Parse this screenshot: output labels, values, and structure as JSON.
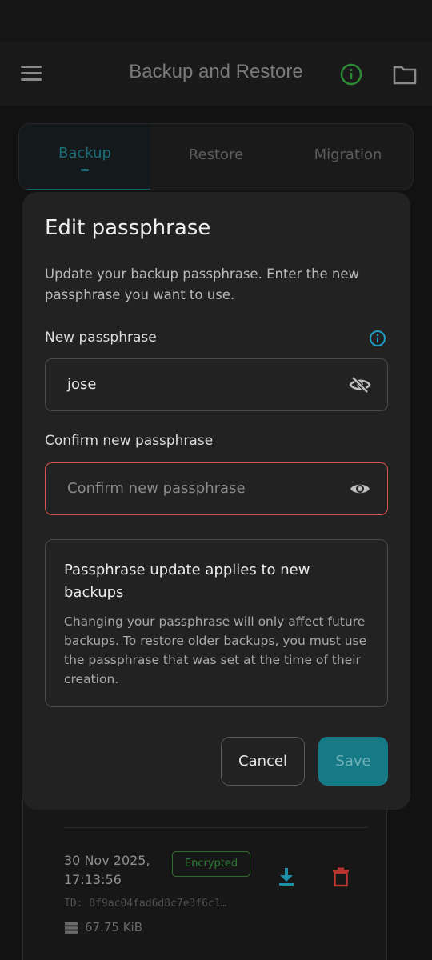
{
  "appbar": {
    "title": "Backup and Restore"
  },
  "tabs": [
    {
      "label": "Backup",
      "active": true
    },
    {
      "label": "Restore",
      "active": false
    },
    {
      "label": "Migration",
      "active": false
    }
  ],
  "dialog": {
    "title": "Edit passphrase",
    "description": "Update your backup passphrase. Enter the new passphrase you want to use.",
    "new_label": "New passphrase",
    "new_value": "jose",
    "confirm_label": "Confirm new passphrase",
    "confirm_placeholder": "Confirm new passphrase",
    "notice_title": "Passphrase update applies to new backups",
    "notice_body": "Changing your passphrase will only affect future backups. To restore older backups, you must use the passphrase that was set at the time of their creation.",
    "cancel_label": "Cancel",
    "save_label": "Save"
  },
  "backup_item": {
    "date": "30 Nov 2025, 17:13:56",
    "badge": "Encrypted",
    "id": "ID: 8f9ac04fad6d8c7e3f6c1…",
    "size": "67.75 KiB"
  },
  "colors": {
    "accent": "#167a86",
    "error": "#d9534a",
    "encrypted": "#2f7a37",
    "delete": "#b8342f",
    "info_green": "#2e8b35",
    "info_blue": "#1d9bc3"
  },
  "icons": [
    "menu-icon",
    "info-icon",
    "folder-icon",
    "eye-off-icon",
    "eye-icon",
    "download-icon",
    "trash-icon",
    "database-icon"
  ]
}
